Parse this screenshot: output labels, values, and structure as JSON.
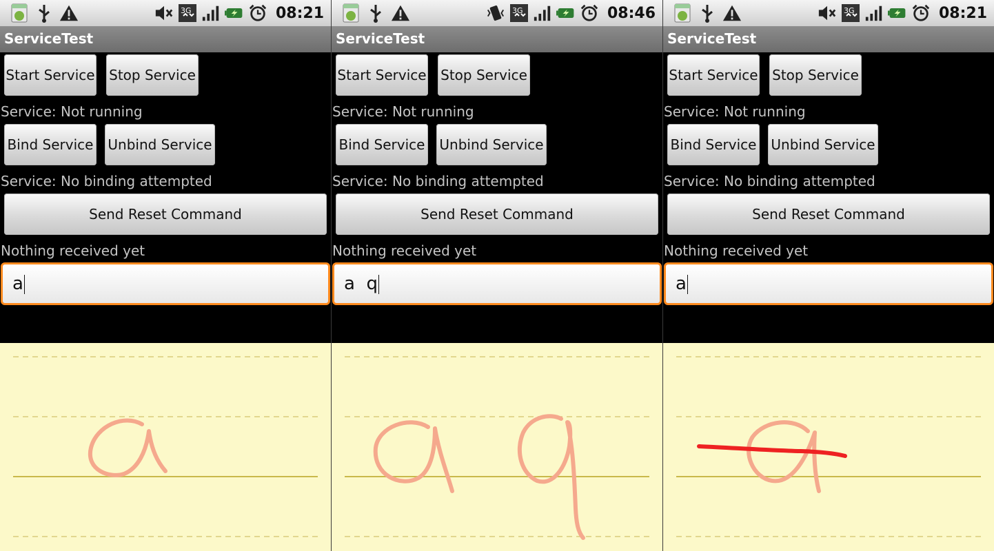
{
  "app_title": "ServiceTest",
  "status_icons": [
    "android-notification-icon",
    "usb-icon",
    "warning-icon",
    "signal-3g-icon",
    "signal-bars-icon",
    "battery-charging-icon",
    "alarm-clock-icon"
  ],
  "buttons": {
    "start_service": "Start Service",
    "stop_service": "Stop Service",
    "bind_service": "Bind Service",
    "unbind_service": "Unbind Service",
    "send_reset": "Send Reset Command"
  },
  "labels": {
    "service_status": "Service: Not running",
    "binding_status": "Service: No binding attempted",
    "received": "Nothing received yet"
  },
  "accent_colors": {
    "input_focus": "#ff8a1e",
    "pad_background": "#fcf9c9",
    "ink": "#f5a98d",
    "strike": "#ee2222",
    "pad_rule": "#c9b94a"
  },
  "panels": [
    {
      "time": "08:21",
      "volume_icon": "mute-icon",
      "input_value": "a"
    },
    {
      "time": "08:46",
      "volume_icon": "vibrate-icon",
      "input_value": "a  q"
    },
    {
      "time": "08:21",
      "volume_icon": "mute-icon",
      "input_value": "a"
    }
  ]
}
